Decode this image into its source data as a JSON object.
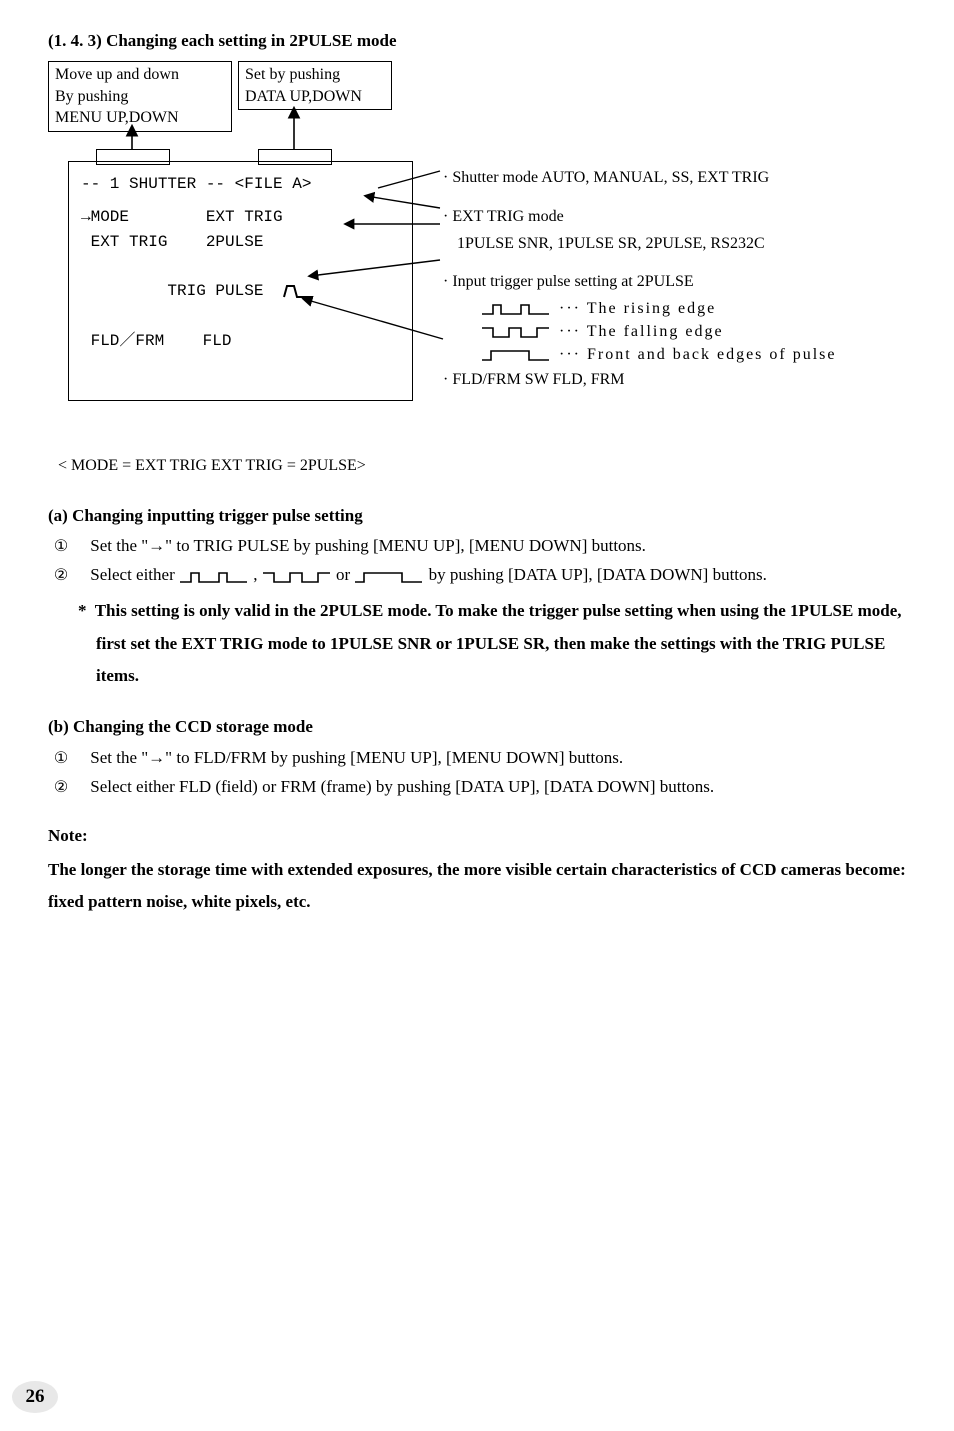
{
  "title": "(1. 4. 3)  Changing each setting in 2PULSE mode",
  "callout_a": "Move up and down\nBy pushing\nMENU UP,DOWN",
  "callout_b": "Set by pushing\nDATA UP,DOWN",
  "screen": {
    "l1": "-- 1 SHUTTER -- <FILE A>",
    "l2": "→MODE        EXT TRIG",
    "l3": " EXT TRIG    2PULSE",
    "l4": " TRIG PULSE  ",
    "l5": " FLD／FRM    FLD"
  },
  "rside": {
    "shutter": "· Shutter mode   AUTO, MANUAL, SS, EXT TRIG",
    "ext_h": "· EXT TRIG mode",
    "ext_v": "1PULSE SNR, 1PULSE SR, 2PULSE, RS232C",
    "inp_h": "· Input trigger pulse setting at 2PULSE",
    "rise": "···  The rising edge",
    "fall": "···  The falling edge",
    "both": "···  Front and back edges of pulse",
    "fld": "·  FLD/FRM SW   FLD, FRM"
  },
  "caption": "< MODE = EXT TRIG   EXT TRIG = 2PULSE>",
  "a": {
    "head": "(a) Changing inputting trigger pulse setting",
    "s1": "Set the \"→\" to TRIG PULSE by pushing [MENU UP], [MENU DOWN] buttons.",
    "s2a": "Select either ",
    "s2b": " , ",
    "s2c": "  or ",
    "s2d": " by pushing [DATA UP], [DATA DOWN] buttons.",
    "star": "This setting is only valid in the 2PULSE mode. To make the trigger pulse setting when using the 1PULSE mode, first set the EXT TRIG mode to 1PULSE SNR or 1PULSE SR, then make the settings with the TRIG PULSE items."
  },
  "b": {
    "head": "(b) Changing the CCD storage mode",
    "s1": "Set the \"→\" to FLD/FRM by pushing [MENU UP], [MENU DOWN] buttons.",
    "s2": "Select either FLD (field) or FRM (frame) by pushing [DATA UP], [DATA DOWN] buttons."
  },
  "note_h": "Note:",
  "note_b": "The longer the storage time with extended exposures, the more visible certain characteristics of CCD cameras become: fixed pattern noise, white pixels, etc.",
  "page_num": "26",
  "glyphs": {
    "c1": "①",
    "c2": "②",
    "star": "*"
  }
}
